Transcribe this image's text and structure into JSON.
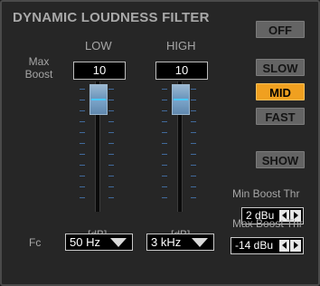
{
  "panel": {
    "title": "DYNAMIC LOUDNESS FILTER",
    "max_boost_label": "Max Boost",
    "fc_label": "Fc"
  },
  "low": {
    "label": "LOW",
    "value": "10",
    "unit": "[dB]",
    "freq": "50 Hz"
  },
  "high": {
    "label": "HIGH",
    "value": "10",
    "unit": "[dB]",
    "freq": "3 kHz"
  },
  "buttons": {
    "off": "OFF",
    "slow": "SLOW",
    "mid": "MID",
    "fast": "FAST",
    "show": "SHOW",
    "active_mode": "MID"
  },
  "min_thr": {
    "label": "Min Boost Thr",
    "value": "2 dBu"
  },
  "max_thr": {
    "label": "Max Boost Thr",
    "value": "-14 dBu"
  },
  "colors": {
    "accent": "#f0a020",
    "thumb": "#6d97bd",
    "tick": "#416a9c"
  },
  "icons": {
    "dropdown": "triangle-down-icon",
    "spin_left": "arrow-left-icon",
    "spin_right": "arrow-right-icon"
  }
}
